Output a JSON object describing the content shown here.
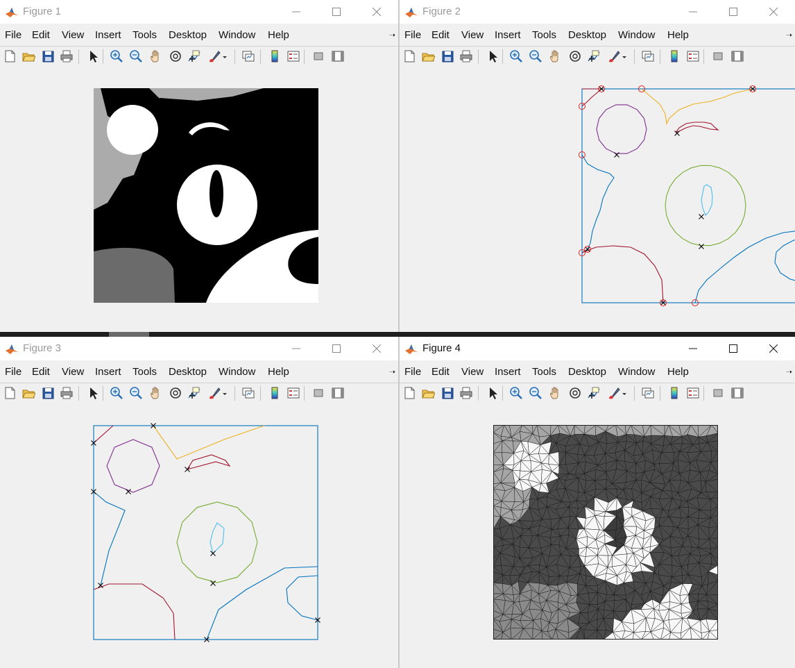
{
  "windows": [
    {
      "title": "Figure 1"
    },
    {
      "title": "Figure 2"
    },
    {
      "title": "Figure 3"
    },
    {
      "title": "Figure 4"
    }
  ],
  "menu": [
    "File",
    "Edit",
    "View",
    "Insert",
    "Tools",
    "Desktop",
    "Window",
    "Help"
  ],
  "toolbar_icons": [
    "new-file-icon",
    "open-file-icon",
    "save-icon",
    "print-icon",
    "pointer-icon",
    "zoom-in-icon",
    "zoom-out-icon",
    "pan-icon",
    "rotate-3d-icon",
    "data-cursor-icon",
    "brush-icon",
    "link-plot-icon",
    "colorbar-icon",
    "legend-icon",
    "hide-plot-tools-icon",
    "show-plot-tools-icon"
  ],
  "colors": {
    "contour_blue": "#0072bd",
    "contour_red": "#a2142f",
    "contour_orange": "#edb120",
    "contour_purple": "#7e2f8e",
    "contour_green": "#77ac30",
    "contour_cyan": "#4dbeee",
    "marker_red": "#e02020",
    "marker_black": "#000000"
  }
}
